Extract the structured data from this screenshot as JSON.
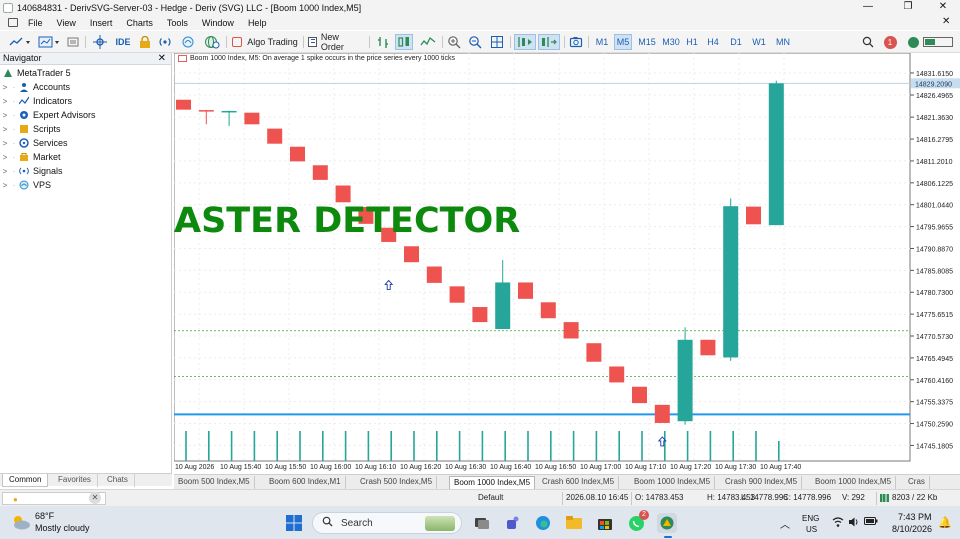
{
  "window": {
    "title": "140684831 - DerivSVG-Server-03 - Hedge - Deriv (SVG) LLC - [Boom 1000 Index,M5]",
    "minimize": "—",
    "maximize": "❐",
    "close": "✕",
    "inner_close": "✕"
  },
  "menu": [
    "File",
    "View",
    "Insert",
    "Charts",
    "Tools",
    "Window",
    "Help"
  ],
  "toolbar": {
    "ide_label": "IDE",
    "algo_label": "Algo Trading",
    "order_label": "New Order",
    "timeframes": [
      "M1",
      "M5",
      "M15",
      "M30",
      "H1",
      "H4",
      "D1",
      "W1",
      "MN"
    ],
    "active_timeframe": "M5",
    "icons": [
      "line-chart-icon",
      "new-chart-icon",
      "crosshair-icon",
      "lock-icon",
      "signal-icon",
      "cloud-icon",
      "globe-icon",
      "algo-trading-icon",
      "new-order-icon",
      "bar-chart-icon",
      "candlestick-icon",
      "line-icon",
      "zoom-in-icon",
      "zoom-out-icon",
      "grid-icon",
      "auto-scroll-icon",
      "chart-shift-icon",
      "screenshot-icon",
      "search-icon",
      "notification-icon",
      "account-icon"
    ],
    "notification_count": "1"
  },
  "navigator": {
    "title": "Navigator",
    "root": "MetaTrader 5",
    "items": [
      {
        "label": "Accounts",
        "icon": "accounts-icon"
      },
      {
        "label": "Indicators",
        "icon": "indicators-icon"
      },
      {
        "label": "Expert Advisors",
        "icon": "expert-advisors-icon"
      },
      {
        "label": "Scripts",
        "icon": "scripts-icon"
      },
      {
        "label": "Services",
        "icon": "services-icon"
      },
      {
        "label": "Market",
        "icon": "market-icon"
      },
      {
        "label": "Signals",
        "icon": "signals-icon"
      },
      {
        "label": "VPS",
        "icon": "vps-icon"
      }
    ],
    "tabs": [
      "Common",
      "Favorites",
      "Chats"
    ],
    "active_tab": "Common"
  },
  "chart": {
    "info": "Boom 1000 Index, M5:  On average 1 spike occurs in the price series every 1000 ticks",
    "overlay_text": "ASTER DETECTOR",
    "colors": {
      "bull": "#26a69a",
      "bear": "#ef5350",
      "line": "#2196f3",
      "level": "#33aa33"
    }
  },
  "chart_data": {
    "type": "candlestick",
    "title": "Boom 1000 Index, M5",
    "ylim": [
      14741.8,
      14833.0
    ],
    "y_ticks": [
      "14831.6150",
      "14826.4965",
      "14821.3630",
      "14816.2795",
      "14811.2010",
      "14806.1225",
      "14801.0440",
      "14795.9655",
      "14790.8870",
      "14785.8085",
      "14780.7300",
      "14775.6515",
      "14770.5730",
      "14765.4945",
      "14760.4160",
      "14755.3375",
      "14750.2590",
      "14745.1805"
    ],
    "current_price": "14829.2090",
    "x_ticks": [
      "10 Aug 2026",
      "10 Aug 15:40",
      "10 Aug 15:50",
      "10 Aug 16:00",
      "10 Aug 16:10",
      "10 Aug 16:20",
      "10 Aug 16:30",
      "10 Aug 16:40",
      "10 Aug 16:50",
      "10 Aug 17:00",
      "10 Aug 17:10",
      "10 Aug 17:20",
      "10 Aug 17:30",
      "10 Aug 17:40"
    ],
    "candles": [
      {
        "o": 14825.4,
        "h": 14825.4,
        "c": 14823.1,
        "l": 14823.1
      },
      {
        "o": 14823.0,
        "h": 14823.0,
        "c": 14822.7,
        "l": 14819.7
      },
      {
        "o": 14822.6,
        "h": 14822.9,
        "c": 14822.8,
        "l": 14819.3
      },
      {
        "o": 14822.4,
        "h": 14822.4,
        "c": 14819.7,
        "l": 14819.7
      },
      {
        "o": 14818.7,
        "h": 14818.7,
        "c": 14815.2,
        "l": 14815.2
      },
      {
        "o": 14814.5,
        "h": 14814.5,
        "c": 14811.1,
        "l": 14811.1
      },
      {
        "o": 14810.2,
        "h": 14810.2,
        "c": 14806.8,
        "l": 14806.8
      },
      {
        "o": 14805.5,
        "h": 14805.5,
        "c": 14801.6,
        "l": 14801.6
      },
      {
        "o": 14800.5,
        "h": 14800.5,
        "c": 14796.6,
        "l": 14796.6
      },
      {
        "o": 14795.7,
        "h": 14795.7,
        "c": 14792.4,
        "l": 14792.4
      },
      {
        "o": 14791.4,
        "h": 14791.4,
        "c": 14787.7,
        "l": 14787.7
      },
      {
        "o": 14786.7,
        "h": 14786.7,
        "c": 14782.9,
        "l": 14782.9
      },
      {
        "o": 14782.1,
        "h": 14782.1,
        "c": 14778.3,
        "l": 14778.3
      },
      {
        "o": 14777.3,
        "h": 14777.3,
        "c": 14773.8,
        "l": 14773.8
      },
      {
        "o": 14772.2,
        "h": 14788.2,
        "c": 14783.0,
        "l": 14772.2
      },
      {
        "o": 14783.0,
        "h": 14783.0,
        "c": 14779.2,
        "l": 14779.2
      },
      {
        "o": 14778.4,
        "h": 14778.4,
        "c": 14774.7,
        "l": 14774.7
      },
      {
        "o": 14773.8,
        "h": 14773.8,
        "c": 14770.0,
        "l": 14770.0
      },
      {
        "o": 14768.9,
        "h": 14768.9,
        "c": 14764.6,
        "l": 14764.6
      },
      {
        "o": 14763.5,
        "h": 14763.5,
        "c": 14759.8,
        "l": 14759.8
      },
      {
        "o": 14758.8,
        "h": 14758.8,
        "c": 14755.0,
        "l": 14755.0
      },
      {
        "o": 14754.6,
        "h": 14754.6,
        "c": 14750.4,
        "l": 14750.4
      },
      {
        "o": 14750.8,
        "h": 14772.6,
        "c": 14769.7,
        "l": 14750.0
      },
      {
        "o": 14769.7,
        "h": 14769.7,
        "c": 14766.1,
        "l": 14766.1
      },
      {
        "o": 14765.6,
        "h": 14802.5,
        "c": 14800.7,
        "l": 14764.8
      },
      {
        "o": 14800.6,
        "h": 14800.6,
        "c": 14796.5,
        "l": 14796.5
      },
      {
        "o": 14796.3,
        "h": 14829.8,
        "c": 14829.2,
        "l": 14796.3
      }
    ],
    "levels": [
      14771.8,
      14761.2
    ],
    "current_line": 14752.4,
    "arrows": [
      {
        "index": 9,
        "price": 14782.3
      },
      {
        "index": 21,
        "price": 14746.0
      }
    ],
    "volumes": [
      30,
      30,
      30,
      30,
      30,
      30,
      30,
      30,
      30,
      30,
      30,
      30,
      30,
      30,
      30,
      30,
      30,
      30,
      30,
      30,
      30,
      30,
      30,
      30,
      30,
      30,
      20
    ]
  },
  "chart_tabs": [
    "Boom 500 Index,M5",
    "Boom 600 Index,M1",
    "Crash 500 Index,M5",
    "Boom 1000 Index,M5",
    "Crash 600 Index,M5",
    "Boom 1000 Index,M5",
    "Crash 900 Index,M5",
    "Boom 1000 Index,M5",
    "Cras"
  ],
  "active_chart_tab": 3,
  "status": {
    "profile": "Default",
    "datetime": "2026.08.10 16:45",
    "open": "O: 14783.453",
    "high": "H: 14783.453",
    "low": "L: 14778.996",
    "close": "C: 14778.996",
    "volume": "V: 292",
    "traffic": "8203 / 22 Kb"
  },
  "taskbar": {
    "temp": "68°F",
    "weather": "Mostly cloudy",
    "search_label": "Search",
    "lang": "ENG",
    "region": "US",
    "time": "7:43 PM",
    "date": "8/10/2026",
    "badge": "2"
  }
}
